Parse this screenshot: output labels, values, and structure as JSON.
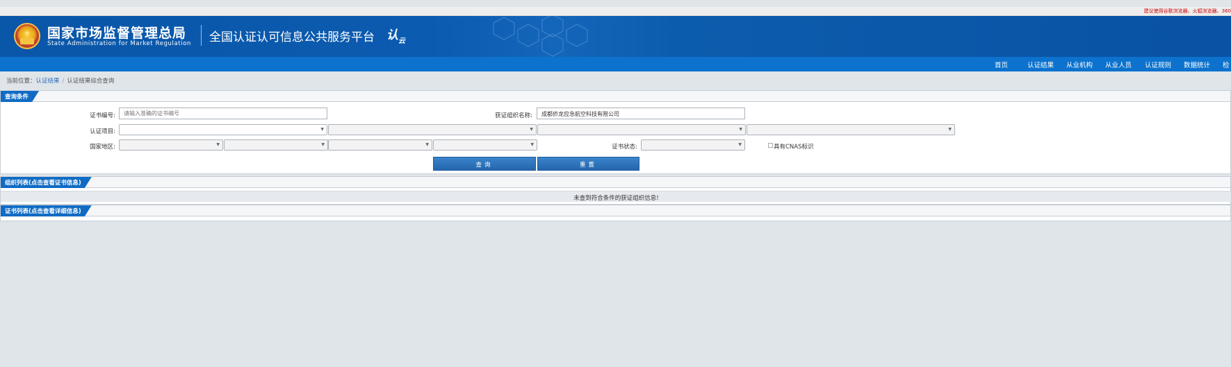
{
  "topbar": {
    "notice": "建议使用谷歌浏览器、火狐浏览器、360"
  },
  "header": {
    "title_cn": "国家市场监督管理总局",
    "title_en": "State Administration for Market Regulation",
    "platform": "全国认证认可信息公共服务平台",
    "logo_text": "认",
    "logo_sub": "云"
  },
  "nav": [
    "首页",
    "认证结果",
    "从业机构",
    "从业人员",
    "认证规则",
    "数据统计",
    "检"
  ],
  "breadcrumb": {
    "prefix": "当前位置：",
    "link": "认证结果",
    "sep": "/",
    "current": "认证结果综合查询"
  },
  "query": {
    "section_title": "查询条件",
    "cert_no_label": "证书编号:",
    "cert_no_placeholder": "请输入准确的证书编号",
    "org_name_label": "获证组织名称:",
    "org_name_value": "成都侨龙应急航空科技有限公司",
    "project_label": "认证项目:",
    "region_label": "国家地区:",
    "status_label": "证书状态:",
    "cnas_label": "具有CNAS标识",
    "search_button": "查询",
    "reset_button": "重置"
  },
  "org_list": {
    "title": "组织列表(点击查看证书信息)",
    "empty_message": "未查到符合条件的获证组织信息!"
  },
  "cert_list": {
    "title": "证书列表(点击查看详细信息)"
  }
}
